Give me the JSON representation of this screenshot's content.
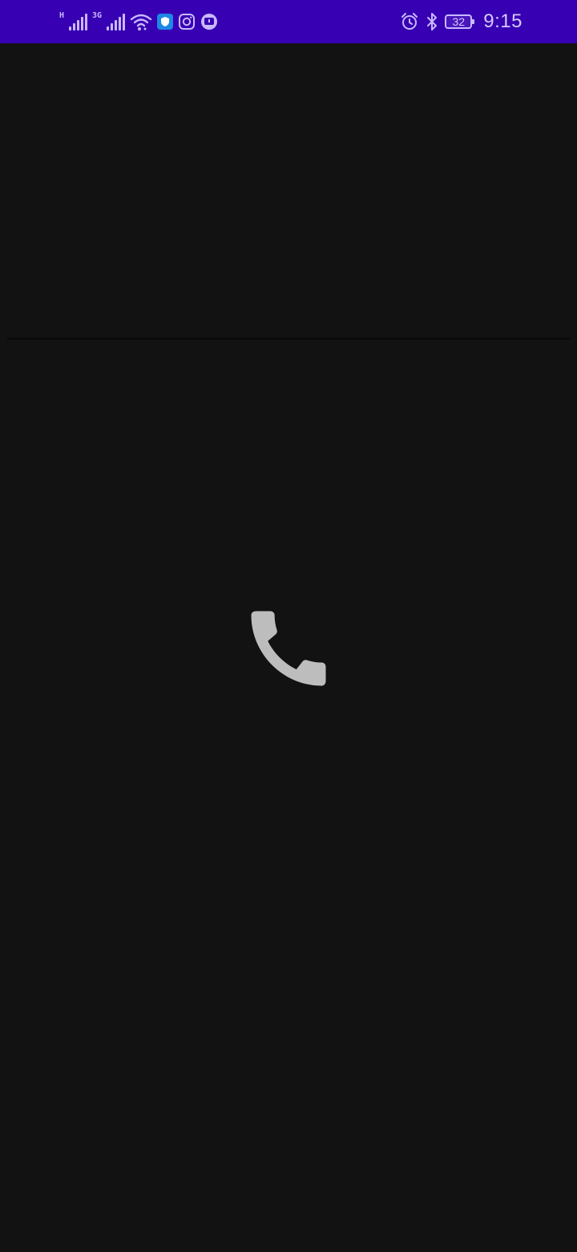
{
  "status_bar": {
    "network_1": "H",
    "network_2": "3G",
    "time": "9:15",
    "battery_level": "32",
    "battery_percent": 32,
    "left_icons": [
      "signal-h-icon",
      "signal-3g-icon",
      "wifi-icon",
      "shield-app-icon",
      "instagram-icon",
      "chat-app-icon"
    ],
    "right_icons": [
      "alarm-icon",
      "bluetooth-icon",
      "battery-icon"
    ]
  },
  "main": {
    "center_icon": "phone-icon"
  },
  "colors": {
    "status_bar": "#3700b3",
    "background": "#121212",
    "icon_tint": "#c9b8ff",
    "phone_icon": "#bdbdbd"
  }
}
